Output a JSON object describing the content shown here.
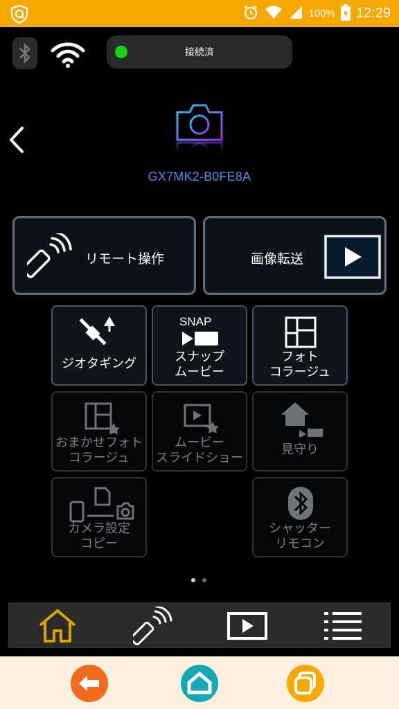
{
  "status_bar": {
    "battery": "100%",
    "time": "12:29",
    "color": "#f5a900"
  },
  "connection": {
    "status": "接続済",
    "dot_color": "#14d414"
  },
  "camera": {
    "name": "GX7MK2-B0FE8A"
  },
  "main_buttons": {
    "remote": "リモート操作",
    "image_transfer": "画像転送"
  },
  "tiles": {
    "geotag": "ジオタギング",
    "snap_movie": "スナップ\nムービー",
    "snap_icon_text": "SNAP",
    "photo_collage": "フォト\nコラージュ",
    "auto_collage": "おまかせフォト\nコラージュ",
    "movie_slideshow": "ムービー\nスライドショー",
    "monitor": "見守り",
    "camera_settings": "カメラ設定\nコピー",
    "shutter_remote": "シャッター\nリモコン"
  },
  "colors": {
    "accent_blue": "#4a90e8",
    "home_active": "#d9a400",
    "sysnav_back": "#f26b1d",
    "sysnav_home": "#17a8b5",
    "sysnav_recent": "#f5a900"
  },
  "icons": {
    "app_nav": [
      "home-icon",
      "remote-icon",
      "playback-icon",
      "menu-icon"
    ],
    "sys_nav": [
      "back-icon",
      "home-icon",
      "recent-apps-icon"
    ]
  }
}
